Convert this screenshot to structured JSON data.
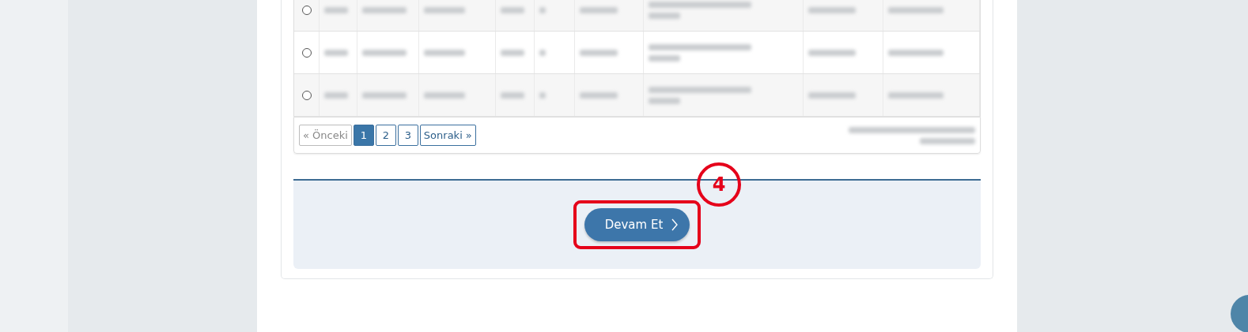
{
  "table": {
    "rows": [
      {
        "selected": false
      },
      {
        "selected": false
      },
      {
        "selected": false
      }
    ]
  },
  "pagination": {
    "previous": "« Önceki",
    "next": "Sonraki »",
    "pages": [
      {
        "label": "1",
        "selected": true
      },
      {
        "label": "2",
        "selected": false
      },
      {
        "label": "3",
        "selected": false
      }
    ]
  },
  "continue_button": {
    "label": "Devam Et"
  },
  "annotation": {
    "number": "4"
  }
}
